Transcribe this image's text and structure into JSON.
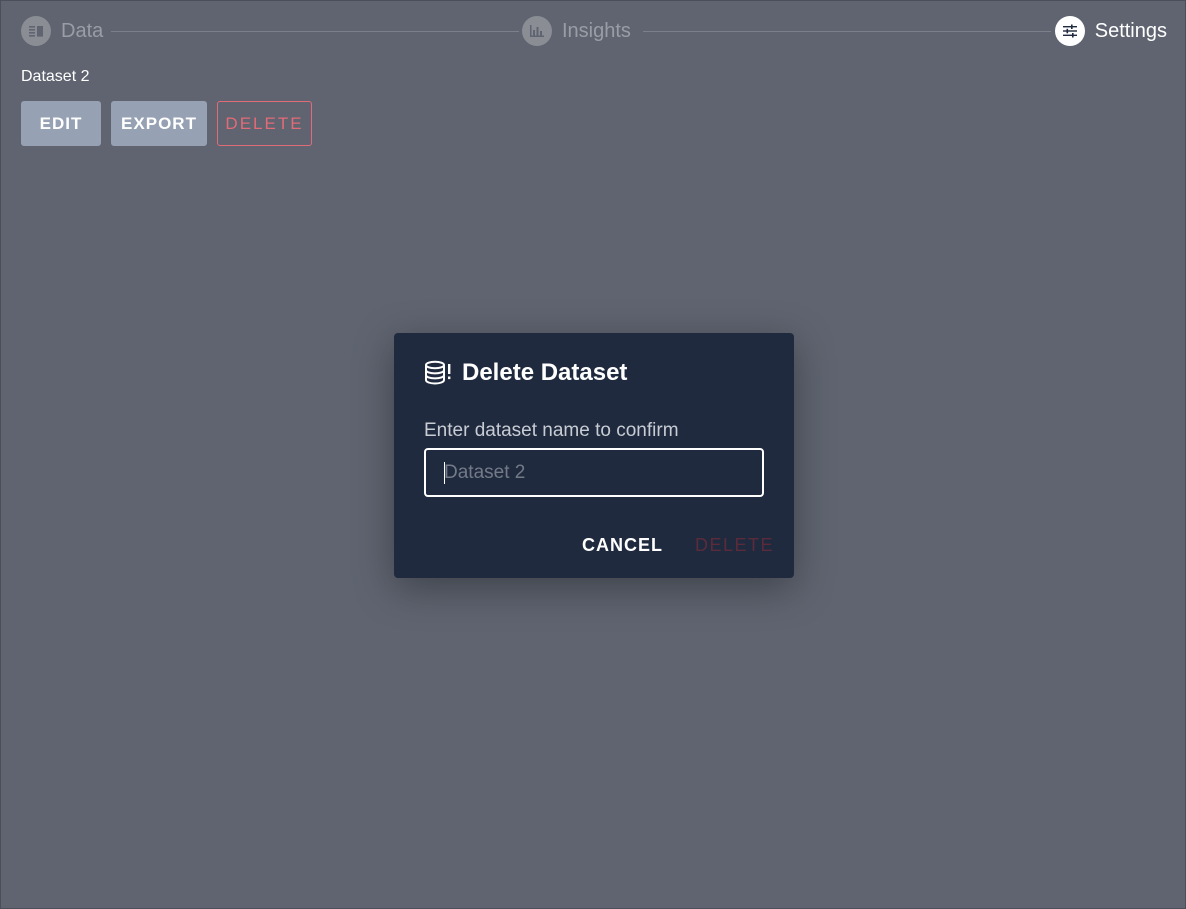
{
  "stepper": {
    "steps": [
      {
        "label": "Data",
        "icon": "table-icon",
        "active": false
      },
      {
        "label": "Insights",
        "icon": "bar-chart-icon",
        "active": false
      },
      {
        "label": "Settings",
        "icon": "sliders-icon",
        "active": true
      }
    ]
  },
  "dataset": {
    "name": "Dataset 2"
  },
  "actions": {
    "edit_label": "EDIT",
    "export_label": "EXPORT",
    "delete_label": "DELETE"
  },
  "modal": {
    "title": "Delete Dataset",
    "icon": "database-alert-icon",
    "field_label": "Enter dataset name to confirm",
    "input_value": "",
    "input_placeholder": "Dataset 2",
    "cancel_label": "CANCEL",
    "confirm_label": "DELETE",
    "confirm_disabled": true
  },
  "colors": {
    "backdrop": "#5f6470",
    "modal_bg": "#1f2a3e",
    "button_solid": "#96a1b3",
    "danger": "#e16b77",
    "danger_disabled": "#5b2b3c"
  }
}
